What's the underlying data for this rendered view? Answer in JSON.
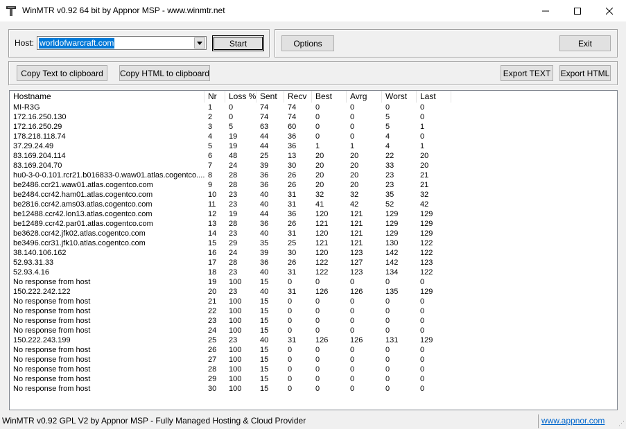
{
  "window": {
    "title": "WinMTR v0.92 64 bit by Appnor MSP - www.winmtr.net",
    "min_glyph": "—",
    "max_glyph": "☐",
    "close_glyph": "✕"
  },
  "host": {
    "label": "Host:",
    "value": "worldofwarcraft.com"
  },
  "buttons": {
    "start": "Start",
    "options": "Options",
    "exit": "Exit",
    "copy_text": "Copy Text to clipboard",
    "copy_html": "Copy HTML to clipboard",
    "export_text": "Export TEXT",
    "export_html": "Export HTML"
  },
  "columns": [
    "Hostname",
    "Nr",
    "Loss %",
    "Sent",
    "Recv",
    "Best",
    "Avrg",
    "Worst",
    "Last"
  ],
  "rows": [
    [
      "MI-R3G",
      "1",
      "0",
      "74",
      "74",
      "0",
      "0",
      "0",
      "0"
    ],
    [
      "172.16.250.130",
      "2",
      "0",
      "74",
      "74",
      "0",
      "0",
      "5",
      "0"
    ],
    [
      "172.16.250.29",
      "3",
      "5",
      "63",
      "60",
      "0",
      "0",
      "5",
      "1"
    ],
    [
      "178.218.118.74",
      "4",
      "19",
      "44",
      "36",
      "0",
      "0",
      "4",
      "0"
    ],
    [
      "37.29.24.49",
      "5",
      "19",
      "44",
      "36",
      "1",
      "1",
      "4",
      "1"
    ],
    [
      "83.169.204.114",
      "6",
      "48",
      "25",
      "13",
      "20",
      "20",
      "22",
      "20"
    ],
    [
      "83.169.204.70",
      "7",
      "24",
      "39",
      "30",
      "20",
      "20",
      "33",
      "20"
    ],
    [
      "hu0-3-0-0.101.rcr21.b016833-0.waw01.atlas.cogentco....",
      "8",
      "28",
      "36",
      "26",
      "20",
      "20",
      "23",
      "21"
    ],
    [
      "be2486.ccr21.waw01.atlas.cogentco.com",
      "9",
      "28",
      "36",
      "26",
      "20",
      "20",
      "23",
      "21"
    ],
    [
      "be2484.ccr42.ham01.atlas.cogentco.com",
      "10",
      "23",
      "40",
      "31",
      "32",
      "32",
      "35",
      "32"
    ],
    [
      "be2816.ccr42.ams03.atlas.cogentco.com",
      "11",
      "23",
      "40",
      "31",
      "41",
      "42",
      "52",
      "42"
    ],
    [
      "be12488.ccr42.lon13.atlas.cogentco.com",
      "12",
      "19",
      "44",
      "36",
      "120",
      "121",
      "129",
      "129"
    ],
    [
      "be12489.ccr42.par01.atlas.cogentco.com",
      "13",
      "28",
      "36",
      "26",
      "121",
      "121",
      "129",
      "129"
    ],
    [
      "be3628.ccr42.jfk02.atlas.cogentco.com",
      "14",
      "23",
      "40",
      "31",
      "120",
      "121",
      "129",
      "129"
    ],
    [
      "be3496.ccr31.jfk10.atlas.cogentco.com",
      "15",
      "29",
      "35",
      "25",
      "121",
      "121",
      "130",
      "122"
    ],
    [
      "38.140.106.162",
      "16",
      "24",
      "39",
      "30",
      "120",
      "123",
      "142",
      "122"
    ],
    [
      "52.93.31.33",
      "17",
      "28",
      "36",
      "26",
      "122",
      "127",
      "142",
      "123"
    ],
    [
      "52.93.4.16",
      "18",
      "23",
      "40",
      "31",
      "122",
      "123",
      "134",
      "122"
    ],
    [
      "No response from host",
      "19",
      "100",
      "15",
      "0",
      "0",
      "0",
      "0",
      "0"
    ],
    [
      "150.222.242.122",
      "20",
      "23",
      "40",
      "31",
      "126",
      "126",
      "135",
      "129"
    ],
    [
      "No response from host",
      "21",
      "100",
      "15",
      "0",
      "0",
      "0",
      "0",
      "0"
    ],
    [
      "No response from host",
      "22",
      "100",
      "15",
      "0",
      "0",
      "0",
      "0",
      "0"
    ],
    [
      "No response from host",
      "23",
      "100",
      "15",
      "0",
      "0",
      "0",
      "0",
      "0"
    ],
    [
      "No response from host",
      "24",
      "100",
      "15",
      "0",
      "0",
      "0",
      "0",
      "0"
    ],
    [
      "150.222.243.199",
      "25",
      "23",
      "40",
      "31",
      "126",
      "126",
      "131",
      "129"
    ],
    [
      "No response from host",
      "26",
      "100",
      "15",
      "0",
      "0",
      "0",
      "0",
      "0"
    ],
    [
      "No response from host",
      "27",
      "100",
      "15",
      "0",
      "0",
      "0",
      "0",
      "0"
    ],
    [
      "No response from host",
      "28",
      "100",
      "15",
      "0",
      "0",
      "0",
      "0",
      "0"
    ],
    [
      "No response from host",
      "29",
      "100",
      "15",
      "0",
      "0",
      "0",
      "0",
      "0"
    ],
    [
      "No response from host",
      "30",
      "100",
      "15",
      "0",
      "0",
      "0",
      "0",
      "0"
    ]
  ],
  "status": {
    "text": "WinMTR v0.92 GPL V2 by Appnor MSP - Fully Managed Hosting & Cloud Provider",
    "link": "www.appnor.com"
  },
  "colors": {
    "selection": "#0078d7",
    "link": "#0066cc",
    "window_bg": "#f0f0f0"
  }
}
